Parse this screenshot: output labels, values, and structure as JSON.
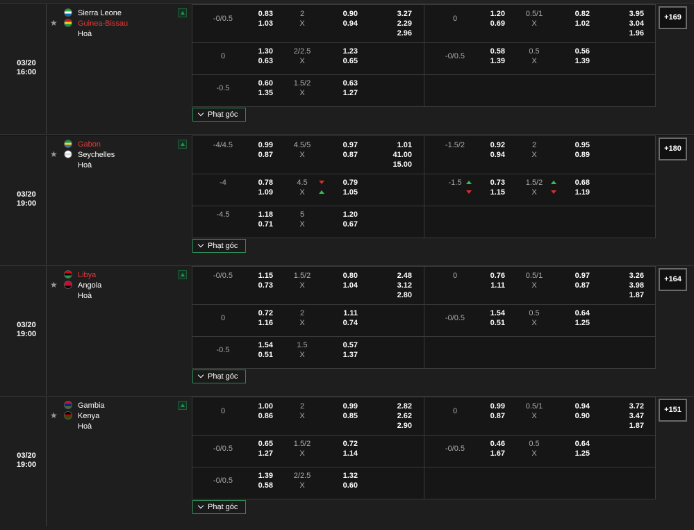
{
  "corner_label": "Phạt góc",
  "draw_label": "Hoà",
  "matches": [
    {
      "date": "03/20",
      "time": "16:00",
      "home": "Sierra Leone",
      "away": "Guinea-Bissau",
      "red": "away",
      "more": "+169",
      "rows": [
        {
          "h1": [
            "-0/0.5",
            "0.83",
            "1.03",
            "2",
            "X",
            "0.90",
            "0.94",
            "3.27",
            "2.29",
            "2.96"
          ],
          "ft": [
            "0",
            "1.20",
            "0.69",
            "0.5/1",
            "X",
            "0.82",
            "1.02",
            "3.95",
            "3.04",
            "1.96"
          ]
        },
        {
          "h1": [
            "0",
            "1.30",
            "0.63",
            "2/2.5",
            "X",
            "1.23",
            "0.65",
            "",
            "",
            ""
          ],
          "ft": [
            "-0/0.5",
            "0.58",
            "1.39",
            "0.5",
            "X",
            "0.56",
            "1.39",
            "",
            "",
            ""
          ]
        },
        {
          "h1": [
            "-0.5",
            "0.60",
            "1.35",
            "1.5/2",
            "X",
            "0.63",
            "1.27",
            "",
            "",
            ""
          ],
          "ft": [
            "",
            "",
            "",
            "",
            "",
            "",
            "",
            "",
            "",
            ""
          ]
        }
      ]
    },
    {
      "date": "03/20",
      "time": "19:00",
      "home": "Gabon",
      "away": "Seychelles",
      "red": "home",
      "more": "+180",
      "rows": [
        {
          "h1": [
            "-4/4.5",
            "0.99",
            "0.87",
            "4.5/5",
            "X",
            "0.97",
            "0.87",
            "1.01",
            "41.00",
            "15.00"
          ],
          "ft": [
            "-1.5/2",
            "0.92",
            "0.94",
            "2",
            "X",
            "0.95",
            "0.89",
            "",
            "",
            ""
          ]
        },
        {
          "h1": [
            "-4",
            "0.78",
            "1.09",
            "4.5",
            "X",
            "0.79",
            "1.05",
            "",
            "",
            ""
          ],
          "ft": [
            "-1.5",
            "0.73",
            "1.15",
            "1.5/2",
            "X",
            "0.68",
            "1.19",
            "",
            "",
            ""
          ]
        },
        {
          "h1": [
            "-4.5",
            "1.18",
            "0.71",
            "5",
            "X",
            "1.20",
            "0.67",
            "",
            "",
            ""
          ],
          "ft": [
            "",
            "",
            "",
            "",
            "",
            "",
            "",
            "",
            "",
            ""
          ]
        }
      ]
    },
    {
      "date": "03/20",
      "time": "19:00",
      "home": "Libya",
      "away": "Angola",
      "red": "home",
      "more": "+164",
      "rows": [
        {
          "h1": [
            "-0/0.5",
            "1.15",
            "0.73",
            "1.5/2",
            "X",
            "0.80",
            "1.04",
            "2.48",
            "3.12",
            "2.80"
          ],
          "ft": [
            "0",
            "0.76",
            "1.11",
            "0.5/1",
            "X",
            "0.97",
            "0.87",
            "3.26",
            "3.98",
            "1.87"
          ]
        },
        {
          "h1": [
            "0",
            "0.72",
            "1.16",
            "2",
            "X",
            "1.11",
            "0.74",
            "",
            "",
            ""
          ],
          "ft": [
            "-0/0.5",
            "1.54",
            "0.51",
            "0.5",
            "X",
            "0.64",
            "1.25",
            "",
            "",
            ""
          ]
        },
        {
          "h1": [
            "-0.5",
            "1.54",
            "0.51",
            "1.5",
            "X",
            "0.57",
            "1.37",
            "",
            "",
            ""
          ],
          "ft": [
            "",
            "",
            "",
            "",
            "",
            "",
            "",
            "",
            "",
            ""
          ]
        }
      ]
    },
    {
      "date": "03/20",
      "time": "19:00",
      "home": "Gambia",
      "away": "Kenya",
      "red": "none",
      "more": "+151",
      "rows": [
        {
          "h1": [
            "0",
            "1.00",
            "0.86",
            "2",
            "X",
            "0.99",
            "0.85",
            "2.82",
            "2.62",
            "2.90"
          ],
          "ft": [
            "0",
            "0.99",
            "0.87",
            "0.5/1",
            "X",
            "0.94",
            "0.90",
            "3.72",
            "3.47",
            "1.87"
          ]
        },
        {
          "h1": [
            "-0/0.5",
            "0.65",
            "1.27",
            "1.5/2",
            "X",
            "0.72",
            "1.14",
            "",
            "",
            ""
          ],
          "ft": [
            "-0/0.5",
            "0.46",
            "1.67",
            "0.5",
            "X",
            "0.64",
            "1.25",
            "",
            "",
            ""
          ]
        },
        {
          "h1": [
            "-0/0.5",
            "1.39",
            "0.58",
            "2/2.5",
            "X",
            "1.32",
            "0.60",
            "",
            "",
            ""
          ],
          "ft": [
            "",
            "",
            "",
            "",
            "",
            "",
            "",
            "",
            "",
            ""
          ]
        }
      ]
    }
  ],
  "colors": {
    "red_team": "#e23a3a",
    "accent_green": "#2f8a55",
    "arrow_up": "#2fbf55",
    "arrow_down": "#e02b2b"
  },
  "icons": {
    "favorite": "star-icon",
    "market": "market-icon",
    "expand": "chevron-down-icon"
  }
}
